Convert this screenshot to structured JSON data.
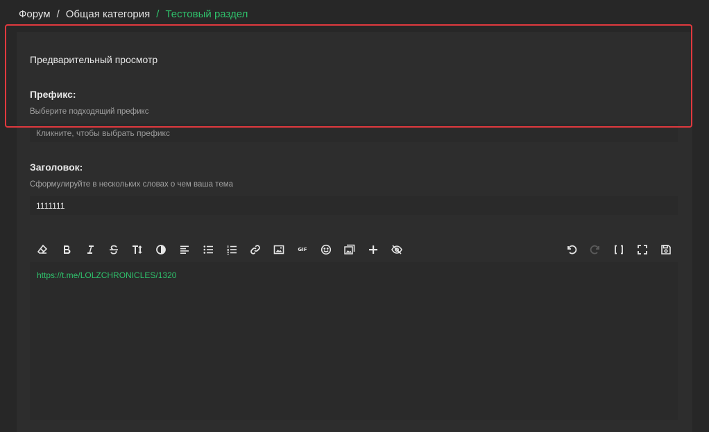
{
  "breadcrumb": {
    "items": [
      {
        "label": "Форум"
      },
      {
        "label": "Общая категория"
      },
      {
        "label": "Тестовый раздел"
      }
    ],
    "separator": "/"
  },
  "preview": {
    "title": "Предварительный просмотр"
  },
  "prefix": {
    "label": "Префикс:",
    "hint": "Выберите подходящий префикс",
    "placeholder": "Кликните, чтобы выбрать префикс"
  },
  "title_field": {
    "label": "Заголовок:",
    "hint": "Сформулируйте в нескольких словах о чем ваша тема",
    "value": "1111111"
  },
  "toolbar": {
    "left": [
      "eraser-icon",
      "bold-icon",
      "italic-icon",
      "strikethrough-icon",
      "text-size-icon",
      "color-icon",
      "align-icon",
      "bullet-list-icon",
      "numbered-list-icon",
      "link-icon",
      "image-icon",
      "gif-icon",
      "emoji-icon",
      "gallery-icon",
      "plus-icon",
      "hide-icon"
    ],
    "right": [
      "undo-icon",
      "redo-icon",
      "brackets-icon",
      "fullscreen-icon",
      "save-icon"
    ],
    "gif_label": "GIF"
  },
  "editor": {
    "content": "https://t.me/LOLZCHRONICLES/1320"
  },
  "colors": {
    "accent": "#2fc26c",
    "highlight_border": "#e0393e",
    "background": "#272727",
    "panel": "#2d2d2d"
  }
}
